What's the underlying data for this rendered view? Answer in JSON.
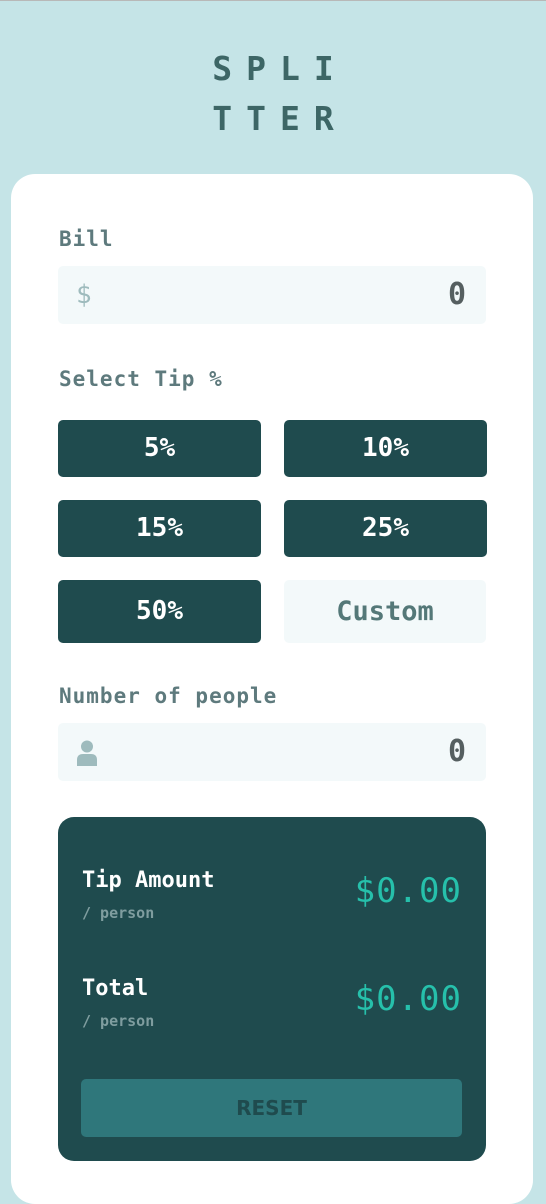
{
  "logo": {
    "line1": "SPLI",
    "line2": "TTER"
  },
  "bill": {
    "label": "Bill",
    "currency_icon": "dollar-icon",
    "currency_symbol": "$",
    "value": "0"
  },
  "tip": {
    "label": "Select Tip %",
    "options": [
      "5%",
      "10%",
      "15%",
      "25%",
      "50%"
    ],
    "custom_placeholder": "Custom"
  },
  "people": {
    "label": "Number of people",
    "icon": "person-icon",
    "value": "0"
  },
  "results": {
    "tip_amount": {
      "title": "Tip Amount",
      "sub": "/ person",
      "value": "$0.00"
    },
    "total": {
      "title": "Total",
      "sub": "/ person",
      "value": "$0.00"
    },
    "reset_label": "RESET"
  },
  "colors": {
    "background": "#c5e4e7",
    "dark_cyan": "#1f4b4e",
    "accent": "#26c0ab",
    "input_bg": "#f3f9fa",
    "reset_bg": "#2f777b"
  }
}
